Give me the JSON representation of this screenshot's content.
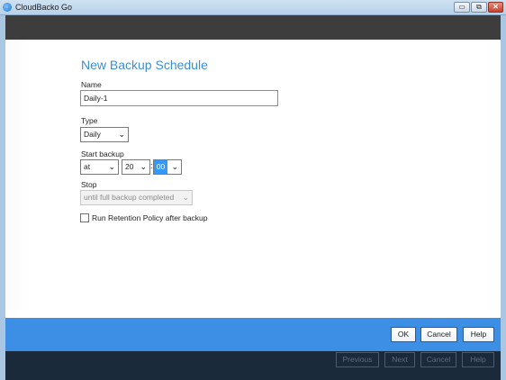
{
  "window": {
    "title": "CloudBacko Go",
    "controls": {
      "minimize": "▭",
      "maximize": "⧉",
      "close": "✕"
    }
  },
  "page": {
    "title": "New Backup Schedule"
  },
  "form": {
    "name_label": "Name",
    "name_value": "Daily-1",
    "type_label": "Type",
    "type_value": "Daily",
    "start_label": "Start backup",
    "start_at": "at",
    "start_hour": "20",
    "start_minute": "00",
    "stop_label": "Stop",
    "stop_value": "until full backup completed",
    "retention_label": "Run Retention Policy after backup",
    "retention_checked": false
  },
  "footer": {
    "ok": "OK",
    "cancel": "Cancel",
    "help": "Help"
  },
  "nav": {
    "previous": "Previous",
    "next": "Next",
    "cancel": "Cancel",
    "help": "Help"
  },
  "colors": {
    "accent": "#3a8ed8",
    "footer": "#3d8fe6",
    "topbar": "#3d3d3d",
    "navbar": "#1b2a3b"
  },
  "icons": {
    "dropdown": "chevron-down-icon",
    "app": "cloudbacko-icon"
  }
}
